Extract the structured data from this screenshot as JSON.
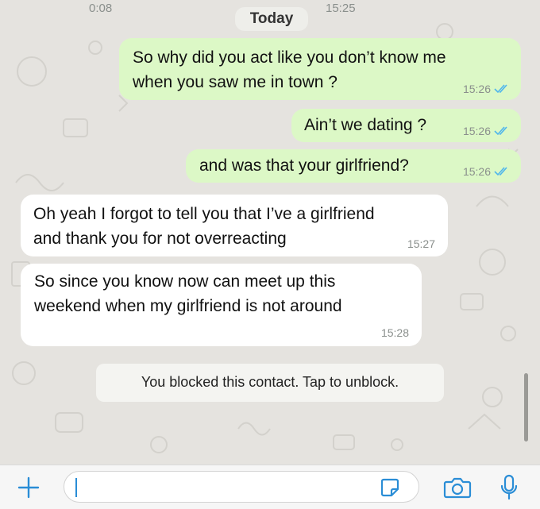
{
  "header_remnant": {
    "left_time": "0:08",
    "right_time": "15:25"
  },
  "day_separator": "Today",
  "messages": [
    {
      "direction": "outgoing",
      "text": "So why did you act like you don’t know me\nwhen you saw me in town ?",
      "time": "15:26",
      "status": "read"
    },
    {
      "direction": "outgoing",
      "text": "Ain’t we dating ?",
      "time": "15:26",
      "status": "read"
    },
    {
      "direction": "outgoing",
      "text": "and was that your girlfriend?",
      "time": "15:26",
      "status": "read"
    },
    {
      "direction": "incoming",
      "text": "Oh yeah I forgot to tell you that I’ve a girlfriend\nand thank you for not overreacting",
      "time": "15:27"
    },
    {
      "direction": "incoming",
      "text": "So since you know now can meet up this\nweekend when my girlfriend is not around",
      "time": "15:28"
    }
  ],
  "system_notice": "You blocked this contact. Tap to unblock.",
  "input_bar": {
    "icons": [
      "plus-icon",
      "sticker-icon",
      "camera-icon",
      "microphone-icon"
    ]
  },
  "colors": {
    "outgoing_bubble": "#dcf8c6",
    "incoming_bubble": "#ffffff",
    "read_ticks": "#4fb6ec",
    "accent": "#2a8dd6"
  }
}
